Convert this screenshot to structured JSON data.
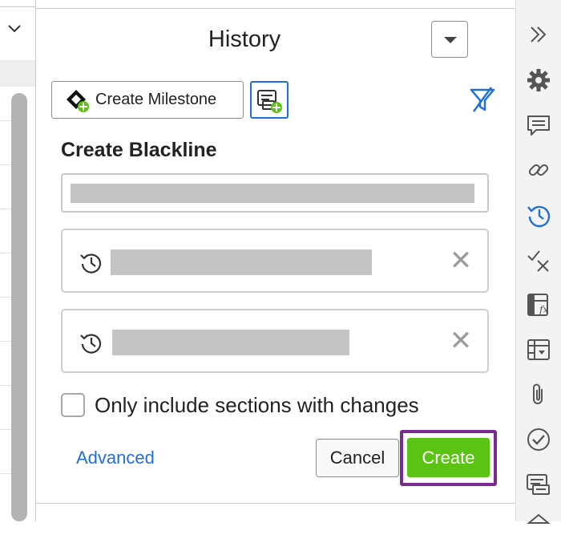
{
  "panel": {
    "title": "History",
    "create_milestone_label": "Create Milestone"
  },
  "blackline": {
    "title": "Create Blackline",
    "only_changes_label": "Only include sections with changes",
    "advanced_label": "Advanced",
    "cancel_label": "Cancel",
    "create_label": "Create"
  },
  "colors": {
    "accent_blue": "#1f6fd6",
    "create_green": "#5bc313",
    "highlight_purple": "#7a2b92"
  },
  "rail_icons": [
    "expand-icon",
    "settings-gear-icon",
    "comments-icon",
    "link-icon",
    "history-icon",
    "proofing-icon",
    "formula-icon",
    "table-icon",
    "attachment-icon",
    "approvals-icon",
    "sections-icon",
    "more-icon"
  ]
}
